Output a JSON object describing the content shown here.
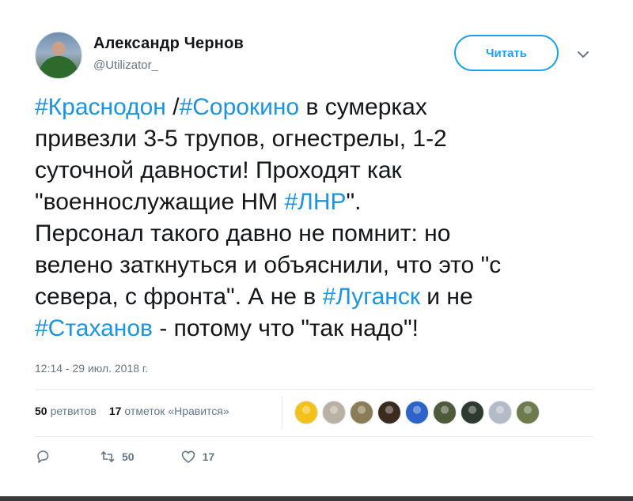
{
  "author": {
    "name": "Александр Чернов",
    "handle": "@Utilizator_"
  },
  "follow_button": {
    "label": "Читать"
  },
  "tweet": {
    "lines": [
      [
        {
          "t": "#Краснодон",
          "tag": true
        },
        {
          "t": " /",
          "tag": false
        },
        {
          "t": "#Сорокино",
          "tag": true
        },
        {
          "t": " в сумерках",
          "tag": false
        }
      ],
      [
        {
          "t": "привезли 3-5 трупов, огнестрелы, 1-2",
          "tag": false
        }
      ],
      [
        {
          "t": "суточной давности! Проходят как",
          "tag": false
        }
      ],
      [
        {
          "t": "\"военнослужащие НМ ",
          "tag": false
        },
        {
          "t": "#ЛНР",
          "tag": true
        },
        {
          "t": "\".",
          "tag": false
        }
      ],
      [
        {
          "t": "Персонал такого давно не помнит: но",
          "tag": false
        }
      ],
      [
        {
          "t": "велено заткнуться и объяснили, что это \"с",
          "tag": false
        }
      ],
      [
        {
          "t": "севера, с фронта\". А не в ",
          "tag": false
        },
        {
          "t": "#Луганск",
          "tag": true
        },
        {
          "t": " и не",
          "tag": false
        }
      ],
      [
        {
          "t": "#Стаханов",
          "tag": true
        },
        {
          "t": " - потому что \"так надо\"!",
          "tag": false
        }
      ]
    ],
    "timestamp": "12:14 - 29 июл. 2018 г."
  },
  "stats": {
    "retweets_count": "50",
    "retweets_label": "ретвитов",
    "likes_count": "17",
    "likes_label": "отметок «Нравится»"
  },
  "likers": [
    {
      "name": "liker-1",
      "color": "#f3c21a"
    },
    {
      "name": "liker-2",
      "color": "#b9b2a4"
    },
    {
      "name": "liker-3",
      "color": "#8a7d55"
    },
    {
      "name": "liker-4",
      "color": "#3b2a1e"
    },
    {
      "name": "liker-5",
      "color": "#2d62c8"
    },
    {
      "name": "liker-6",
      "color": "#4e5a3a"
    },
    {
      "name": "liker-7",
      "color": "#2f3a2e"
    },
    {
      "name": "liker-8",
      "color": "#b3bcc6"
    },
    {
      "name": "liker-9",
      "color": "#6d7a4e"
    }
  ],
  "actions": {
    "reply_icon": "reply-icon",
    "retweet_icon": "retweet-icon",
    "retweet_count": "50",
    "like_icon": "heart-icon",
    "like_count": "17"
  },
  "colors": {
    "accent": "#1da1f2",
    "hashtag": "#1b95e0",
    "muted": "#657786"
  }
}
